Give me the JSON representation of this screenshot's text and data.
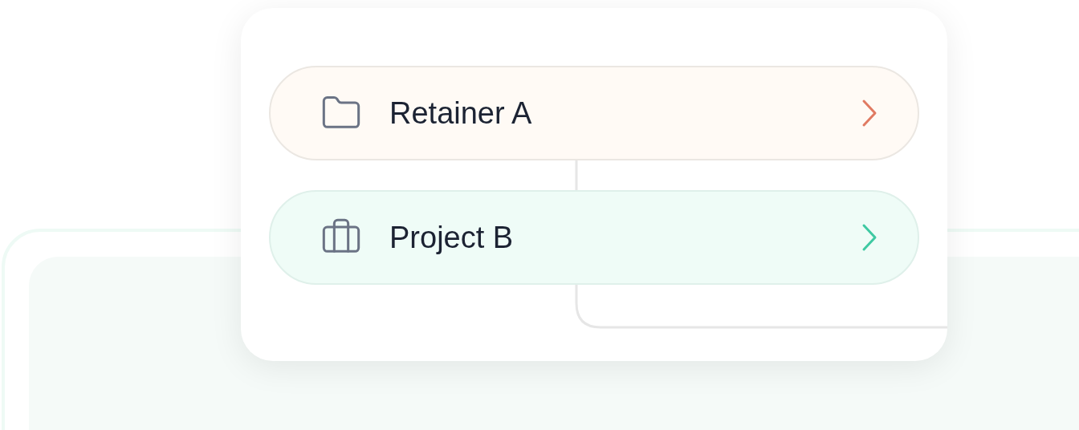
{
  "rows": [
    {
      "kind": "folder",
      "label": "Retainer A",
      "color": "#e07a62"
    },
    {
      "kind": "briefcase",
      "label": "Project B",
      "color": "#3ec9a2"
    }
  ]
}
